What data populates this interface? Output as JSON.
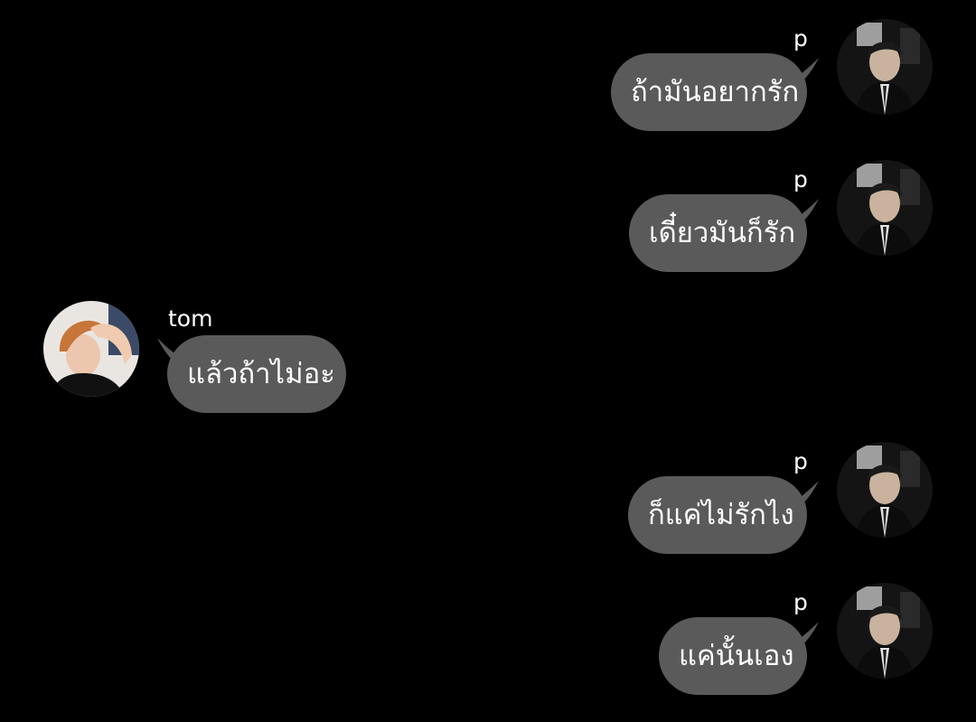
{
  "messages": [
    {
      "sender": "p",
      "text": "ถ้ามันอยากรัก",
      "side": "right",
      "avatar": "avatar-p"
    },
    {
      "sender": "p",
      "text": "เดี๋ยวมันก็รัก",
      "side": "right",
      "avatar": "avatar-p"
    },
    {
      "sender": "tom",
      "text": "แล้วถ้าไม่อะ",
      "side": "left",
      "avatar": "avatar-tom"
    },
    {
      "sender": "p",
      "text": "ก็แค่ไม่รักไง",
      "side": "right",
      "avatar": "avatar-p"
    },
    {
      "sender": "p",
      "text": "แค่นั้นเอง",
      "side": "right",
      "avatar": "avatar-p"
    }
  ],
  "colors": {
    "background": "#000000",
    "bubble": "#5a5a5a",
    "text": "#ffffff"
  }
}
